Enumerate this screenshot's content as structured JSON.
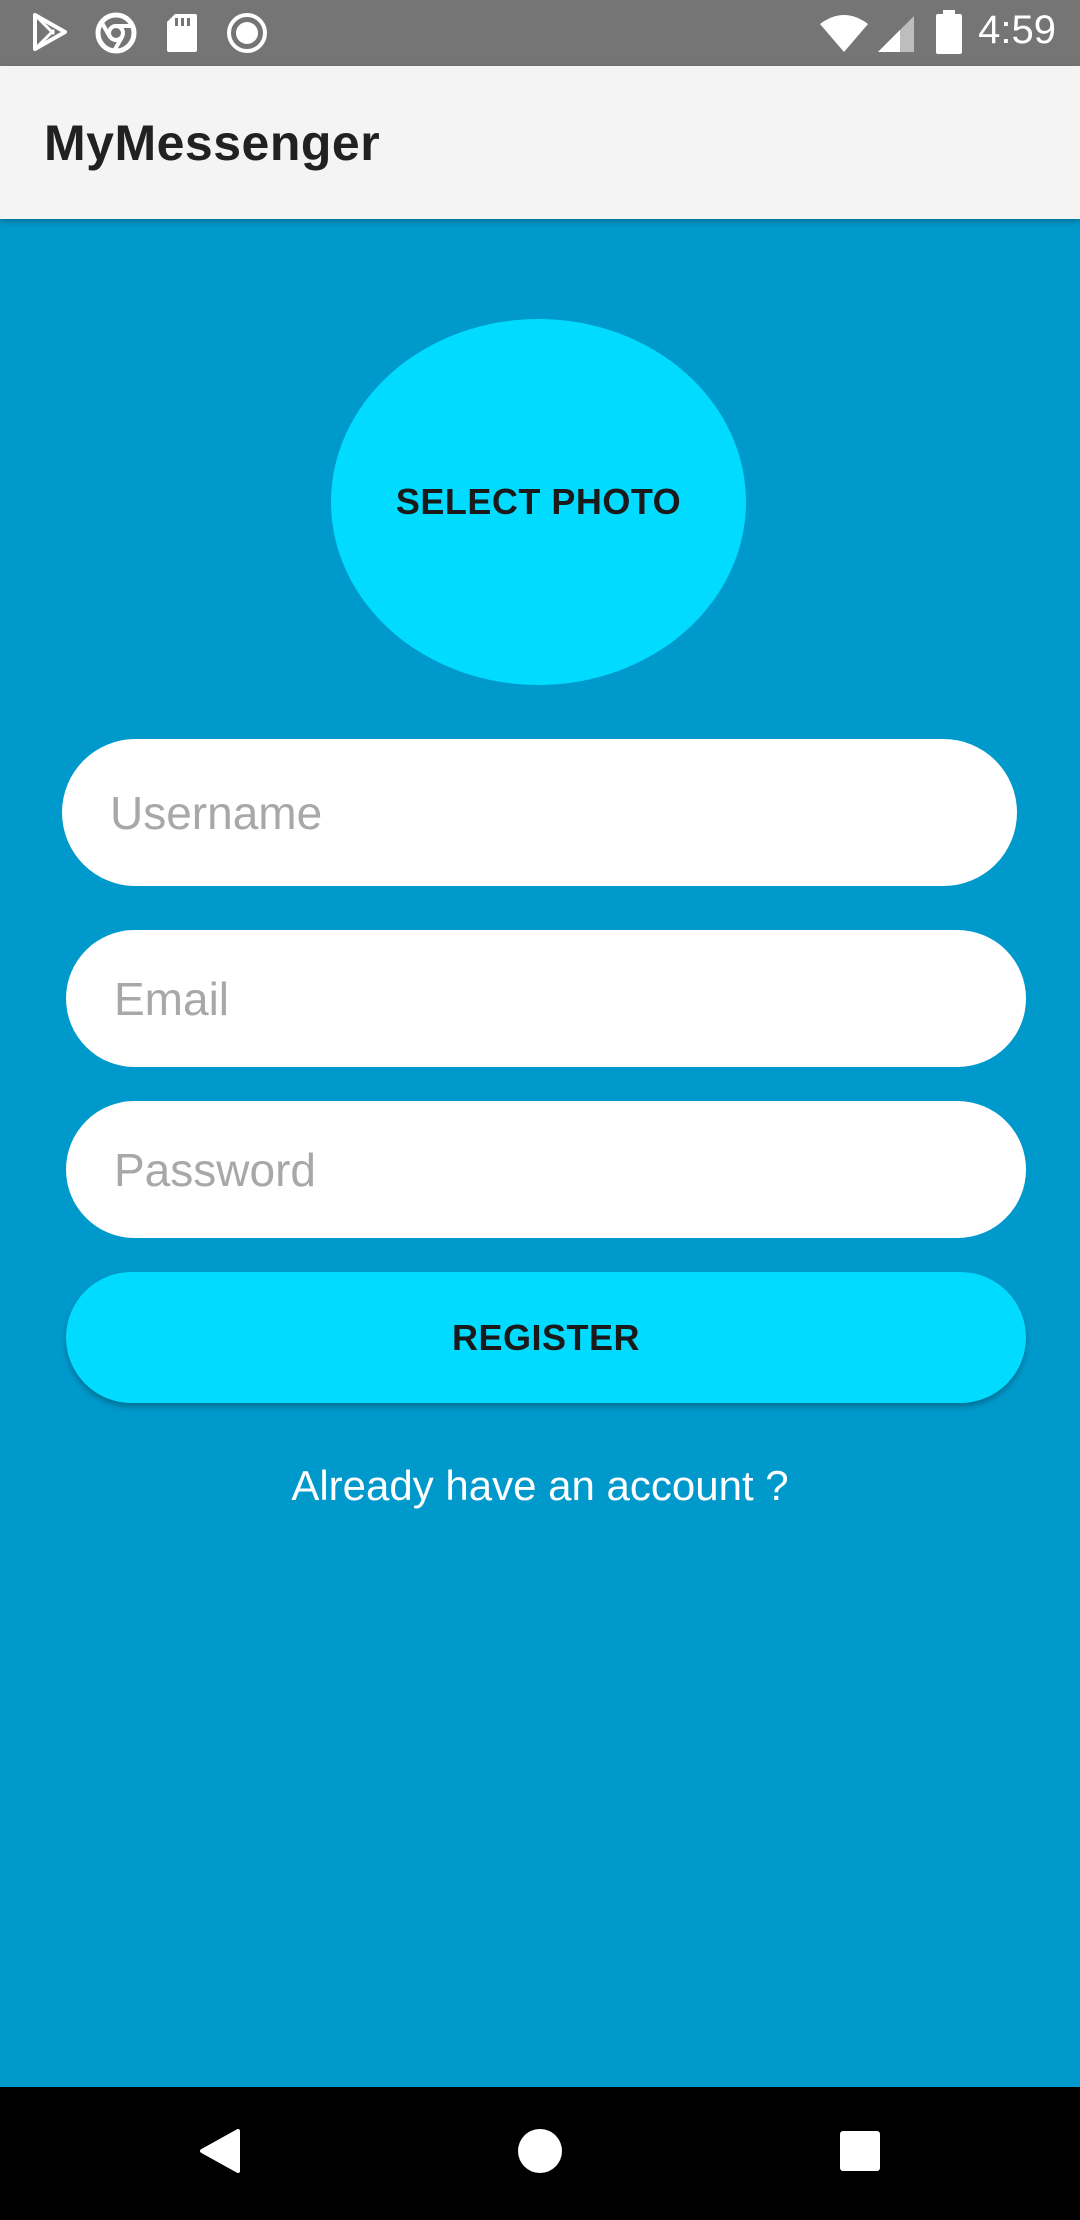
{
  "status_bar": {
    "time": "4:59",
    "icons": [
      "play-store-icon",
      "chrome-icon",
      "sd-card-icon",
      "record-icon",
      "wifi-icon",
      "signal-icon",
      "battery-icon"
    ]
  },
  "app_bar": {
    "title": "MyMessenger"
  },
  "form": {
    "select_photo_label": "SELECT PHOTO",
    "username": {
      "placeholder": "Username",
      "value": ""
    },
    "email": {
      "placeholder": "Email",
      "value": ""
    },
    "password": {
      "placeholder": "Password",
      "value": ""
    },
    "register_label": "REGISTER",
    "login_link_text": "Already have an account ?"
  },
  "nav_bar": {
    "buttons": [
      "back-icon",
      "home-icon",
      "recents-icon"
    ]
  },
  "colors": {
    "background": "#0099cc",
    "accent": "#00dbff",
    "app_bar": "#f4f4f4",
    "status_bar": "#757575"
  }
}
